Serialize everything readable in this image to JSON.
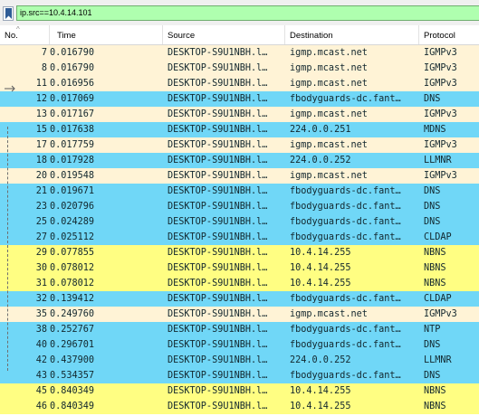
{
  "filter": {
    "value": "ip.src==10.4.14.101",
    "bar_color": "#afffaf"
  },
  "icons": {
    "bookmark": "bookmark-icon",
    "sort": "sort-ascending-icon",
    "related_packet": "related-packet-arrow-icon"
  },
  "columns": [
    "No.",
    "Time",
    "Source",
    "Destination",
    "Protocol"
  ],
  "colors": {
    "igmp": "#fff3d6",
    "udp": "#daeeff",
    "tcp": "#e7e6ff",
    "nbns": "#fffe82",
    "dns_cyan": "#70d7f7",
    "text": "#12272e"
  },
  "rows": [
    {
      "no": "7",
      "time": "0.016790",
      "source": "DESKTOP-S9U1NBH.l…",
      "destination": "igmp.mcast.net",
      "protocol": "IGMPv3",
      "color": "#fff3d6"
    },
    {
      "no": "8",
      "time": "0.016790",
      "source": "DESKTOP-S9U1NBH.l…",
      "destination": "igmp.mcast.net",
      "protocol": "IGMPv3",
      "color": "#fff3d6"
    },
    {
      "no": "11",
      "time": "0.016956",
      "source": "DESKTOP-S9U1NBH.l…",
      "destination": "igmp.mcast.net",
      "protocol": "IGMPv3",
      "color": "#fff3d6"
    },
    {
      "no": "12",
      "time": "0.017069",
      "source": "DESKTOP-S9U1NBH.l…",
      "destination": "fbodyguards-dc.fant…",
      "protocol": "DNS",
      "color": "#70d7f7"
    },
    {
      "no": "13",
      "time": "0.017167",
      "source": "DESKTOP-S9U1NBH.l…",
      "destination": "igmp.mcast.net",
      "protocol": "IGMPv3",
      "color": "#fff3d6"
    },
    {
      "no": "15",
      "time": "0.017638",
      "source": "DESKTOP-S9U1NBH.l…",
      "destination": "224.0.0.251",
      "protocol": "MDNS",
      "color": "#70d7f7"
    },
    {
      "no": "17",
      "time": "0.017759",
      "source": "DESKTOP-S9U1NBH.l…",
      "destination": "igmp.mcast.net",
      "protocol": "IGMPv3",
      "color": "#fff3d6"
    },
    {
      "no": "18",
      "time": "0.017928",
      "source": "DESKTOP-S9U1NBH.l…",
      "destination": "224.0.0.252",
      "protocol": "LLMNR",
      "color": "#70d7f7"
    },
    {
      "no": "20",
      "time": "0.019548",
      "source": "DESKTOP-S9U1NBH.l…",
      "destination": "igmp.mcast.net",
      "protocol": "IGMPv3",
      "color": "#fff3d6"
    },
    {
      "no": "21",
      "time": "0.019671",
      "source": "DESKTOP-S9U1NBH.l…",
      "destination": "fbodyguards-dc.fant…",
      "protocol": "DNS",
      "color": "#70d7f7"
    },
    {
      "no": "23",
      "time": "0.020796",
      "source": "DESKTOP-S9U1NBH.l…",
      "destination": "fbodyguards-dc.fant…",
      "protocol": "DNS",
      "color": "#70d7f7"
    },
    {
      "no": "25",
      "time": "0.024289",
      "source": "DESKTOP-S9U1NBH.l…",
      "destination": "fbodyguards-dc.fant…",
      "protocol": "DNS",
      "color": "#70d7f7"
    },
    {
      "no": "27",
      "time": "0.025112",
      "source": "DESKTOP-S9U1NBH.l…",
      "destination": "fbodyguards-dc.fant…",
      "protocol": "CLDAP",
      "color": "#70d7f7"
    },
    {
      "no": "29",
      "time": "0.077855",
      "source": "DESKTOP-S9U1NBH.l…",
      "destination": "10.4.14.255",
      "protocol": "NBNS",
      "color": "#fffe82"
    },
    {
      "no": "30",
      "time": "0.078012",
      "source": "DESKTOP-S9U1NBH.l…",
      "destination": "10.4.14.255",
      "protocol": "NBNS",
      "color": "#fffe82"
    },
    {
      "no": "31",
      "time": "0.078012",
      "source": "DESKTOP-S9U1NBH.l…",
      "destination": "10.4.14.255",
      "protocol": "NBNS",
      "color": "#fffe82"
    },
    {
      "no": "32",
      "time": "0.139412",
      "source": "DESKTOP-S9U1NBH.l…",
      "destination": "fbodyguards-dc.fant…",
      "protocol": "CLDAP",
      "color": "#70d7f7"
    },
    {
      "no": "35",
      "time": "0.249760",
      "source": "DESKTOP-S9U1NBH.l…",
      "destination": "igmp.mcast.net",
      "protocol": "IGMPv3",
      "color": "#fff3d6"
    },
    {
      "no": "38",
      "time": "0.252767",
      "source": "DESKTOP-S9U1NBH.l…",
      "destination": "fbodyguards-dc.fant…",
      "protocol": "NTP",
      "color": "#70d7f7"
    },
    {
      "no": "40",
      "time": "0.296701",
      "source": "DESKTOP-S9U1NBH.l…",
      "destination": "fbodyguards-dc.fant…",
      "protocol": "DNS",
      "color": "#70d7f7"
    },
    {
      "no": "42",
      "time": "0.437900",
      "source": "DESKTOP-S9U1NBH.l…",
      "destination": "224.0.0.252",
      "protocol": "LLMNR",
      "color": "#70d7f7"
    },
    {
      "no": "43",
      "time": "0.534357",
      "source": "DESKTOP-S9U1NBH.l…",
      "destination": "fbodyguards-dc.fant…",
      "protocol": "DNS",
      "color": "#70d7f7"
    },
    {
      "no": "45",
      "time": "0.840349",
      "source": "DESKTOP-S9U1NBH.l…",
      "destination": "10.4.14.255",
      "protocol": "NBNS",
      "color": "#fffe82"
    },
    {
      "no": "46",
      "time": "0.840349",
      "source": "DESKTOP-S9U1NBH.l…",
      "destination": "10.4.14.255",
      "protocol": "NBNS",
      "color": "#fffe82"
    }
  ]
}
